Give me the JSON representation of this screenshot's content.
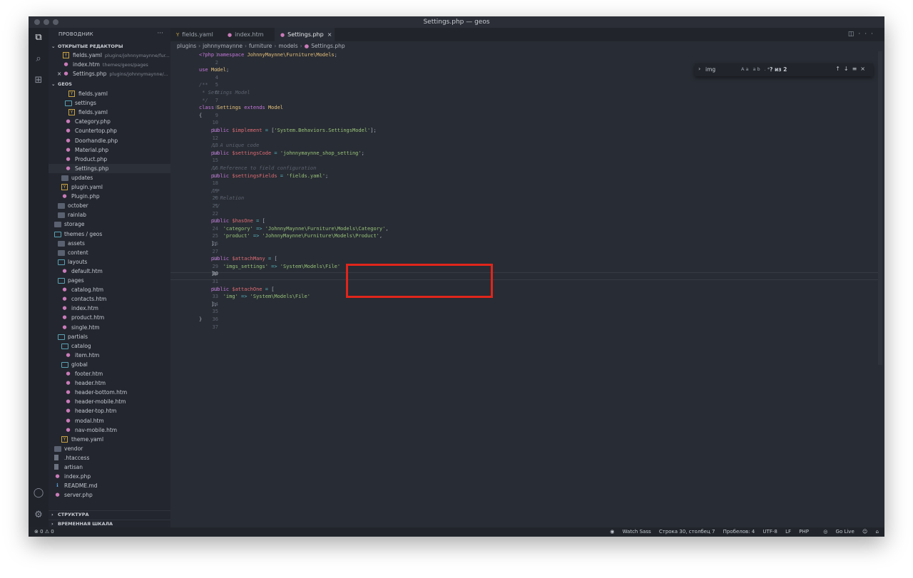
{
  "window": {
    "title": "Settings.php — geos"
  },
  "sidebar": {
    "header": "ПРОВОДНИК",
    "more": "···",
    "open_editors": {
      "title": "ОТКРЫТЫЕ РЕДАКТОРЫ",
      "items": [
        {
          "name": "fields.yaml",
          "path": "plugins/johnnymaynne/fur..."
        },
        {
          "name": "index.htm",
          "path": "themes/geos/pages"
        },
        {
          "name": "Settings.php",
          "path": "plugins/johnnymaynne/..."
        }
      ]
    },
    "workspace": {
      "title": "GEOS"
    },
    "tree": [
      {
        "name": "fields.yaml",
        "type": "yaml",
        "indent": 4
      },
      {
        "name": "settings",
        "type": "folder-open",
        "indent": 3
      },
      {
        "name": "fields.yaml",
        "type": "yaml",
        "indent": 4
      },
      {
        "name": "Category.php",
        "type": "php",
        "indent": 3
      },
      {
        "name": "Countertop.php",
        "type": "php",
        "indent": 3
      },
      {
        "name": "Doorhandle.php",
        "type": "php",
        "indent": 3
      },
      {
        "name": "Material.php",
        "type": "php",
        "indent": 3
      },
      {
        "name": "Product.php",
        "type": "php",
        "indent": 3
      },
      {
        "name": "Settings.php",
        "type": "php",
        "indent": 3,
        "selected": true
      },
      {
        "name": "updates",
        "type": "folder",
        "indent": 2
      },
      {
        "name": "plugin.yaml",
        "type": "yaml",
        "indent": 2
      },
      {
        "name": "Plugin.php",
        "type": "php",
        "indent": 2
      },
      {
        "name": "october",
        "type": "folder",
        "indent": 1
      },
      {
        "name": "rainlab",
        "type": "folder",
        "indent": 1
      },
      {
        "name": "storage",
        "type": "folder",
        "indent": 0
      },
      {
        "name": "themes / geos",
        "type": "folder-open",
        "indent": 0
      },
      {
        "name": "assets",
        "type": "folder",
        "indent": 1
      },
      {
        "name": "content",
        "type": "folder",
        "indent": 1
      },
      {
        "name": "layouts",
        "type": "folder-open",
        "indent": 1
      },
      {
        "name": "default.htm",
        "type": "htm",
        "indent": 2
      },
      {
        "name": "pages",
        "type": "folder-open",
        "indent": 1
      },
      {
        "name": "catalog.htm",
        "type": "htm",
        "indent": 2
      },
      {
        "name": "contacts.htm",
        "type": "htm",
        "indent": 2
      },
      {
        "name": "index.htm",
        "type": "htm",
        "indent": 2
      },
      {
        "name": "product.htm",
        "type": "htm",
        "indent": 2
      },
      {
        "name": "single.htm",
        "type": "htm",
        "indent": 2
      },
      {
        "name": "partials",
        "type": "folder-open",
        "indent": 1
      },
      {
        "name": "catalog",
        "type": "folder-open",
        "indent": 2
      },
      {
        "name": "item.htm",
        "type": "htm",
        "indent": 3
      },
      {
        "name": "global",
        "type": "folder-open",
        "indent": 2
      },
      {
        "name": "footer.htm",
        "type": "htm",
        "indent": 3
      },
      {
        "name": "header.htm",
        "type": "htm",
        "indent": 3
      },
      {
        "name": "header-bottom.htm",
        "type": "htm",
        "indent": 3
      },
      {
        "name": "header-mobile.htm",
        "type": "htm",
        "indent": 3
      },
      {
        "name": "header-top.htm",
        "type": "htm",
        "indent": 3
      },
      {
        "name": "modal.htm",
        "type": "htm",
        "indent": 3
      },
      {
        "name": "nav-mobile.htm",
        "type": "htm",
        "indent": 3
      },
      {
        "name": "theme.yaml",
        "type": "yaml",
        "indent": 2
      },
      {
        "name": "vendor",
        "type": "folder",
        "indent": 0
      },
      {
        "name": ".htaccess",
        "type": "file",
        "indent": 0
      },
      {
        "name": "artisan",
        "type": "file",
        "indent": 0
      },
      {
        "name": "index.php",
        "type": "php",
        "indent": 0
      },
      {
        "name": "README.md",
        "type": "info",
        "indent": 0
      },
      {
        "name": "server.php",
        "type": "php",
        "indent": 0
      }
    ],
    "outline_title": "СТРУКТУРА",
    "timeline_title": "ВРЕМЕННАЯ ШКАЛА"
  },
  "tabs": [
    {
      "label": "fields.yaml",
      "icon": "yaml-file-icon"
    },
    {
      "label": "index.htm",
      "icon": "elephant-file-icon"
    },
    {
      "label": "Settings.php",
      "icon": "elephant-file-icon",
      "active": true
    }
  ],
  "breadcrumb": [
    "plugins",
    "johnnymaynne",
    "furniture",
    "models",
    "Settings.php"
  ],
  "find": {
    "value": "img",
    "options": "Aa ab .*",
    "count": "? из 2"
  },
  "code_lines": [
    [
      [
        "kw",
        "<?php "
      ],
      [
        "kw",
        "namespace "
      ],
      [
        "cls",
        "JohnnyMaynne\\Furniture\\Models"
      ],
      [
        "pun",
        ";"
      ]
    ],
    [],
    [
      [
        "kw",
        "use "
      ],
      [
        "cls",
        "Model"
      ],
      [
        "pun",
        ";"
      ]
    ],
    [],
    [
      [
        "cm",
        "/**"
      ]
    ],
    [
      [
        "cm",
        " * Settings Model"
      ]
    ],
    [
      [
        "cm",
        " */"
      ]
    ],
    [
      [
        "kw",
        "class "
      ],
      [
        "cls",
        "Settings "
      ],
      [
        "kw",
        "extends "
      ],
      [
        "cls",
        "Model"
      ]
    ],
    [
      [
        "pun",
        "{"
      ]
    ],
    [],
    [
      [
        "pun",
        "    "
      ],
      [
        "kw",
        "public "
      ],
      [
        "var",
        "$implement"
      ],
      [
        "op",
        " = "
      ],
      [
        "pun",
        "["
      ],
      [
        "str",
        "'System.Behaviors.SettingsModel'"
      ],
      [
        "pun",
        "];"
      ]
    ],
    [],
    [
      [
        "cm",
        "    // A unique code"
      ]
    ],
    [
      [
        "pun",
        "    "
      ],
      [
        "kw",
        "public "
      ],
      [
        "var",
        "$settingsCode"
      ],
      [
        "op",
        " = "
      ],
      [
        "str",
        "'johnnymaynne_shop_setting'"
      ],
      [
        "pun",
        ";"
      ]
    ],
    [],
    [
      [
        "cm",
        "    // Reference to field configuration"
      ]
    ],
    [
      [
        "pun",
        "    "
      ],
      [
        "kw",
        "public "
      ],
      [
        "var",
        "$settingsFields"
      ],
      [
        "op",
        " = "
      ],
      [
        "str",
        "'fields.yaml'"
      ],
      [
        "pun",
        ";"
      ]
    ],
    [],
    [
      [
        "cm",
        "    /**"
      ]
    ],
    [
      [
        "cm",
        "     * Relation"
      ]
    ],
    [
      [
        "cm",
        "     */"
      ]
    ],
    [],
    [
      [
        "pun",
        "    "
      ],
      [
        "kw",
        "public "
      ],
      [
        "var",
        "$hasOne"
      ],
      [
        "op",
        " = "
      ],
      [
        "pun",
        "["
      ]
    ],
    [
      [
        "pun",
        "        "
      ],
      [
        "str",
        "'category'"
      ],
      [
        "op",
        " => "
      ],
      [
        "str",
        "'JohnnyMaynne\\Furniture\\Models\\Category'"
      ],
      [
        "pun",
        ","
      ]
    ],
    [
      [
        "pun",
        "        "
      ],
      [
        "str",
        "'product'"
      ],
      [
        "op",
        " => "
      ],
      [
        "str",
        "'JohnnyMaynne\\Furniture\\Models\\Product'"
      ],
      [
        "pun",
        ","
      ]
    ],
    [
      [
        "pun",
        "    ];"
      ]
    ],
    [],
    [
      [
        "pun",
        "    "
      ],
      [
        "kw",
        "public "
      ],
      [
        "var",
        "$attachMany"
      ],
      [
        "op",
        " = "
      ],
      [
        "pun",
        "["
      ]
    ],
    [
      [
        "pun",
        "        "
      ],
      [
        "str",
        "'imgs_settings'"
      ],
      [
        "op",
        " => "
      ],
      [
        "str",
        "'System\\Models\\File'"
      ]
    ],
    [
      [
        "pun",
        "    ];"
      ]
    ],
    [],
    [
      [
        "pun",
        "    "
      ],
      [
        "kw",
        "public "
      ],
      [
        "var",
        "$attachOne"
      ],
      [
        "op",
        " = "
      ],
      [
        "pun",
        "["
      ]
    ],
    [
      [
        "pun",
        "        "
      ],
      [
        "str",
        "'img'"
      ],
      [
        "op",
        " => "
      ],
      [
        "str",
        "'System\\Models\\File'"
      ]
    ],
    [
      [
        "pun",
        "    ];"
      ]
    ],
    [],
    [
      [
        "pun",
        "}"
      ]
    ],
    []
  ],
  "status": {
    "problems": "⊗ 0 ⚠ 0",
    "right": [
      "Watch Sass",
      "Строка 30, столбец 7",
      "Пробелов: 4",
      "UTF-8",
      "LF",
      "PHP",
      "Go Live"
    ]
  }
}
